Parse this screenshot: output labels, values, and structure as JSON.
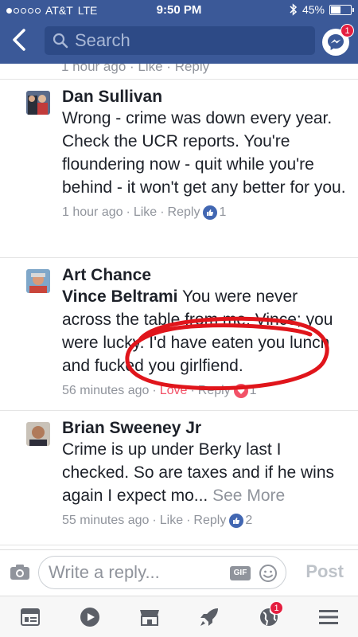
{
  "status_bar": {
    "carrier": "AT&T",
    "network": "LTE",
    "time": "9:50 PM",
    "battery": "45%"
  },
  "header": {
    "search_placeholder": "Search",
    "messenger_badge": "1"
  },
  "partial_top_meta": "1 hour ago · Like · Reply",
  "comments": [
    {
      "author": "Dan Sullivan",
      "mention": "",
      "text": "Wrong - crime was down every year. Check the UCR reports. You're floundering now - quit while you're behind - it won't get any better for you.",
      "time": "1 hour ago",
      "action1": "Like",
      "action2": "Reply",
      "reaction_count": "1"
    },
    {
      "author": "Art Chance",
      "mention": "Vince Beltrami",
      "text": "You were never across the table from me, Vince; you were lucky.  I'd have eaten you lunch and fucked you girlfiend.",
      "time": "56 minutes ago",
      "action1": "Love",
      "action2": "Reply",
      "reaction_count": "1"
    },
    {
      "author": "Brian Sweeney Jr",
      "mention": "",
      "text": "Crime is up under Berky last I checked. So are taxes and if he wins again I expect mo...",
      "see_more": "See More",
      "time": "55 minutes ago",
      "action1": "Like",
      "action2": "Reply",
      "reaction_count": "2"
    }
  ],
  "reply_bar": {
    "placeholder": "Write a reply...",
    "gif_label": "GIF",
    "post_label": "Post"
  },
  "tab_bar": {
    "tabs": [
      "news-feed-icon",
      "video-icon",
      "marketplace-icon",
      "rocket-icon",
      "notifications-globe-icon",
      "menu-icon"
    ],
    "notifications_badge": "1"
  },
  "colors": {
    "brand": "#3b5998",
    "annotation_red": "#e0151b"
  }
}
